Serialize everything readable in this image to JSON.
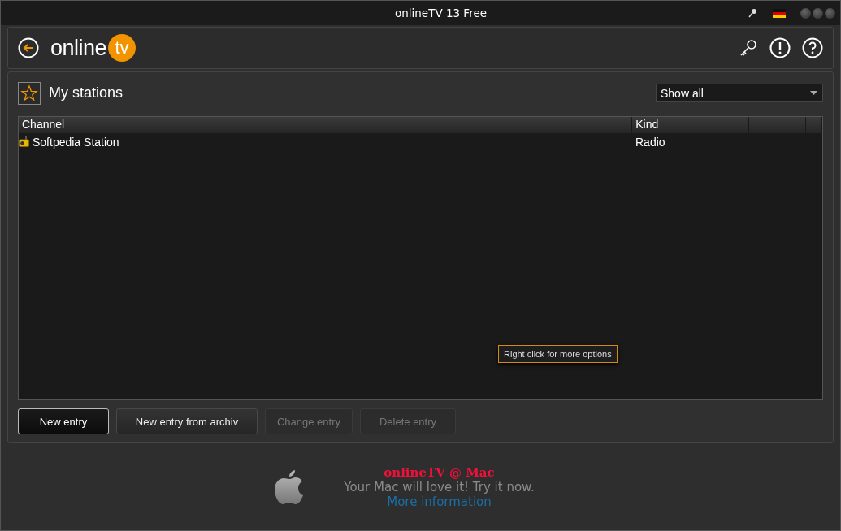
{
  "window": {
    "title": "onlineTV 13 Free"
  },
  "logo": {
    "word": "online",
    "badge": "tv"
  },
  "panel": {
    "title": "My stations",
    "filter": {
      "value": "Show all"
    }
  },
  "table": {
    "columns": [
      "Channel",
      "Kind",
      "",
      ""
    ],
    "rows": [
      {
        "channel": "Softpedia Station",
        "kind": "Radio"
      }
    ]
  },
  "tooltip": "Right click for more options",
  "buttons": [
    {
      "label": "New entry",
      "focused": true,
      "disabled": false
    },
    {
      "label": "New entry from archiv",
      "focused": false,
      "disabled": false
    },
    {
      "label": "Change entry",
      "focused": false,
      "disabled": true
    },
    {
      "label": "Delete entry",
      "focused": false,
      "disabled": true
    }
  ],
  "promo": {
    "title": "onlineTV @ Mac",
    "text": "Your Mac will love it! Try it now.",
    "link": "More information"
  }
}
